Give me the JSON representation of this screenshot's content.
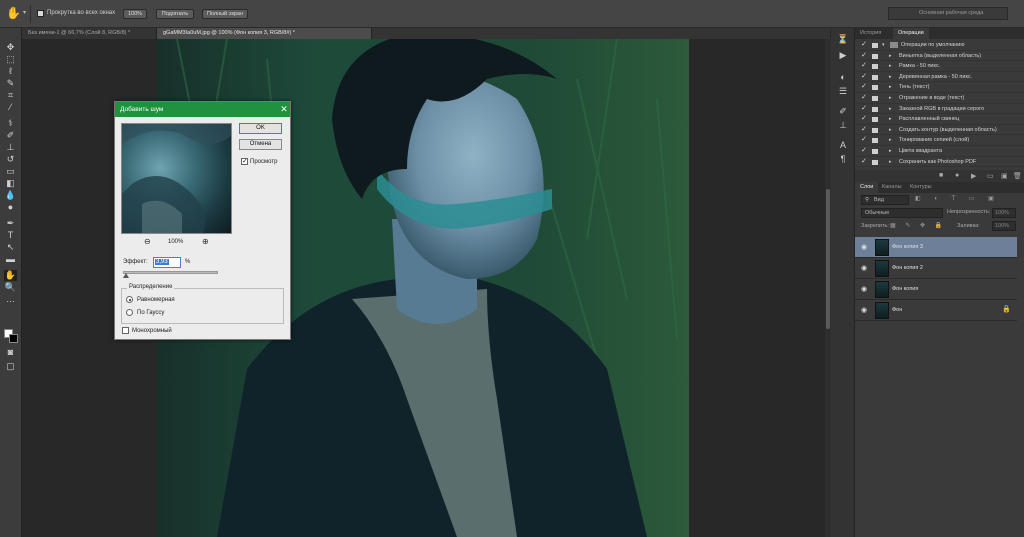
{
  "options_bar": {
    "scroll_all_windows_label": "Прокрутка во всех окнах",
    "btn_100": "100%",
    "btn_fit": "Подогнать",
    "btn_fullscreen": "Полный экран",
    "workspace": "Основная рабочая среда"
  },
  "tabs": [
    {
      "label": "Без имени-1 @ 66,7% (Слой 8, RGB/8) *"
    },
    {
      "label": "gGaMM3Ia0uM.jpg @ 100% (Фон копия 3, RGB/8#) *"
    }
  ],
  "right_panel": {
    "tabs_top": [
      "История",
      "Операции"
    ],
    "actions": [
      "Операции по умолчанию",
      "Виньетка (выделенная область)",
      "Рамка - 50 пикс.",
      "Деревянная рамка - 50 пикс.",
      "Тень (текст)",
      "Отражение в воде (текст)",
      "Заказной RGB в градации серого",
      "Расплавленный свинец",
      "Создать контур (выделенная область)",
      "Тонирование сепией (слой)",
      "Цвета квадранта",
      "Сохранить как Photoshop PDF"
    ],
    "tabs_layers": [
      "Слои",
      "Каналы",
      "Контуры"
    ],
    "kind_label": "Вид",
    "blend_mode": "Обычные",
    "opacity_label": "Непрозрачность:",
    "opacity_value": "100%",
    "lock_label": "Закрепить:",
    "fill_label": "Заливка:",
    "fill_value": "100%",
    "layers": [
      {
        "name": "Фон копия 3",
        "selected": true
      },
      {
        "name": "Фон копия 2",
        "selected": false
      },
      {
        "name": "Фон копия",
        "selected": false
      },
      {
        "name": "Фон",
        "selected": false,
        "locked": true
      }
    ]
  },
  "dialog": {
    "title": "Добавить шум",
    "ok": "OK",
    "cancel": "Отмена",
    "preview_label": "Просмотр",
    "zoom": "100%",
    "effect_label": "Эффект:",
    "effect_value": "3,93",
    "effect_unit": "%",
    "distribution_label": "Распределение",
    "uniform": "Равномерная",
    "gaussian": "По Гауссу",
    "monochrome": "Монохромный"
  },
  "colors": {
    "dialog_title_bar": "#20913d",
    "selected_layer": "#6e7f9a"
  }
}
